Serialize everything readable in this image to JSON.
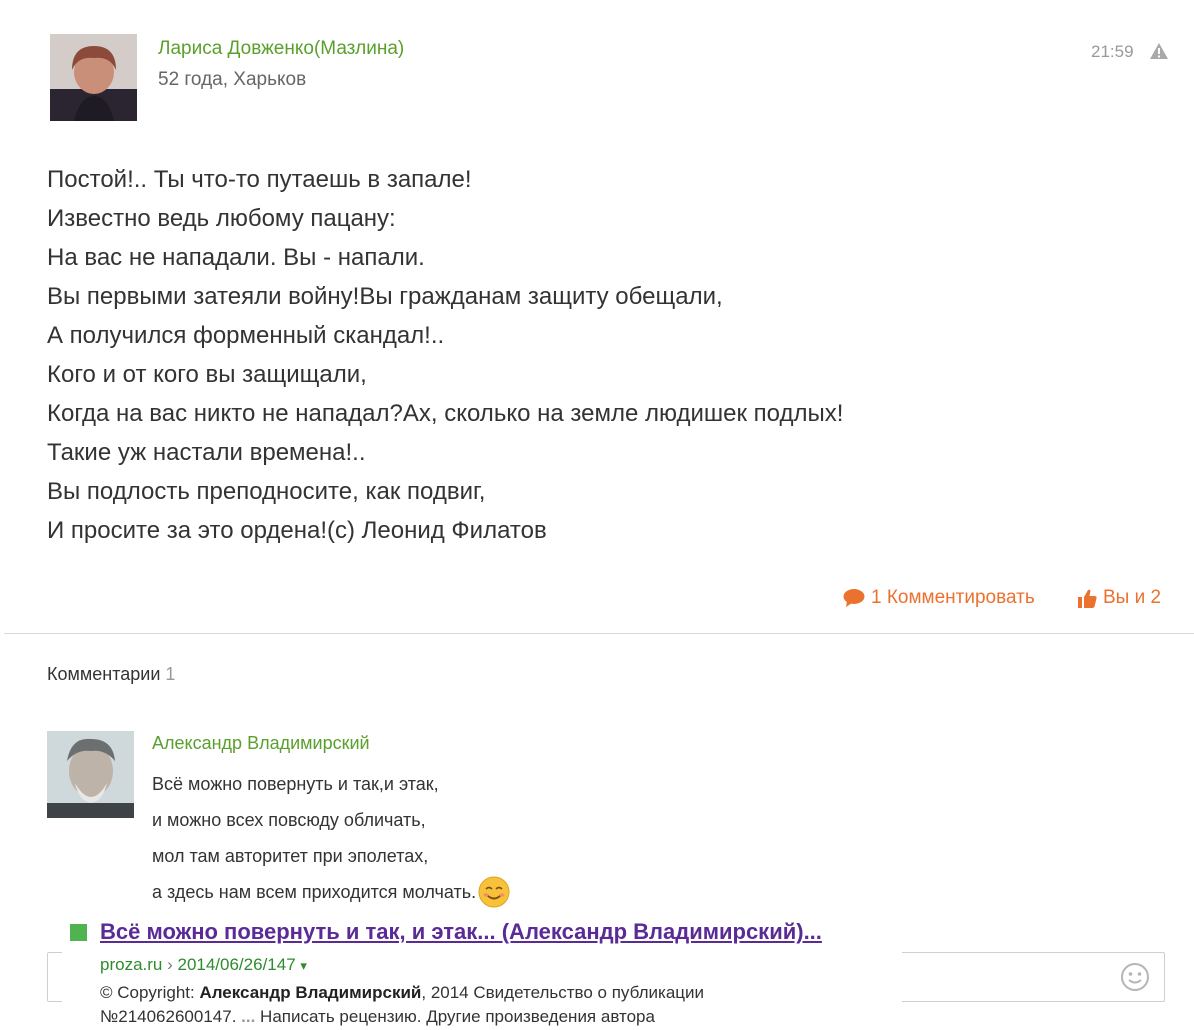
{
  "post": {
    "author": "Лариса Довженко(Мазлина)",
    "meta": "52 года, Харьков",
    "time": "21:59",
    "lines": [
      "Постой!.. Ты что-то путаешь в запале!",
      "Известно ведь любому пацану:",
      "На вас не нападали. Вы - напали.",
      "Вы первыми затеяли войну!Вы гражданам защиту обещали,",
      "А получился форменный скандал!..",
      "Кого и от кого вы защищали,",
      "Когда на вас никто не нападал?Ах, сколько на земле людишек подлых!",
      "Такие уж настали времена!..",
      "Вы подлость преподносите, как подвиг,",
      "И просите за это ордена!(с) Леонид Филатов"
    ],
    "comment_action": "1 Комментировать",
    "like_action": "Вы и 2"
  },
  "comments": {
    "title": "Комментарии",
    "count": "1",
    "items": [
      {
        "author": "Александр Владимирский",
        "lines": [
          "Всё можно повернуть и так,и этак,",
          "и можно всех повсюду обличать,",
          "мол там авторитет при эполетах,",
          "а здесь нам всем приходится молчать."
        ]
      }
    ]
  },
  "snippet": {
    "title": "Всё можно повернуть и так, и этак... (Александр Владимирский)...",
    "url_domain": "proza.ru",
    "url_sep": " › ",
    "url_path": "2014/06/26/147",
    "url_arrow": "▾",
    "copyright_label": "© Copyright: ",
    "copyright_author": "Александр Владимирский",
    "copyright_rest": ", 2014 Свидетельство о публикации",
    "line2_num": "№214062600147. ",
    "line2_dots": "...",
    "line2_rest": " Написать рецензию. Другие произведения автора"
  },
  "colors": {
    "author_green": "#5aa02c",
    "action_orange": "#eb722e",
    "snippet_title": "#5a2a96",
    "snippet_url": "#2e8b2e"
  },
  "icons": [
    "warning-icon",
    "speech-bubble-icon",
    "thumbs-up-icon",
    "smile-emoji-icon",
    "smiley-icon"
  ]
}
